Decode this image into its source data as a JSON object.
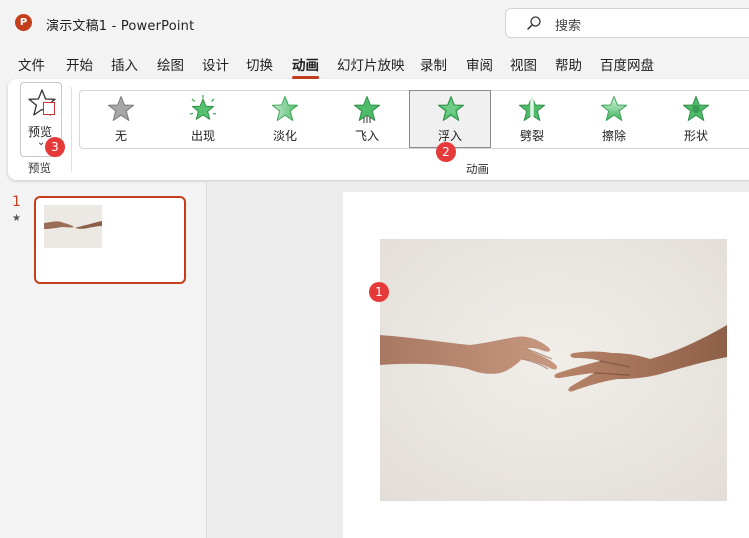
{
  "titlebar": {
    "app_name": "PowerPoint",
    "doc_title": "演示文稿1  -  PowerPoint",
    "search_placeholder": "搜索",
    "app_logo_letter": "P"
  },
  "menu": {
    "tabs": [
      {
        "label": "文件"
      },
      {
        "label": "开始"
      },
      {
        "label": "插入"
      },
      {
        "label": "绘图"
      },
      {
        "label": "设计"
      },
      {
        "label": "切换"
      },
      {
        "label": "动画",
        "active": true
      },
      {
        "label": "幻灯片放映"
      },
      {
        "label": "录制"
      },
      {
        "label": "审阅"
      },
      {
        "label": "视图"
      },
      {
        "label": "帮助"
      },
      {
        "label": "百度网盘"
      }
    ]
  },
  "ribbon": {
    "preview": {
      "button_label": "预览",
      "group_label": "预览"
    },
    "animation_group_label": "动画",
    "animations": [
      {
        "label": "无",
        "icon": "star-gray-icon"
      },
      {
        "label": "出现",
        "icon": "star-appear-icon"
      },
      {
        "label": "淡化",
        "icon": "star-fade-icon"
      },
      {
        "label": "飞入",
        "icon": "star-fly-in-icon"
      },
      {
        "label": "浮入",
        "icon": "star-float-in-icon",
        "selected": true
      },
      {
        "label": "劈裂",
        "icon": "star-split-icon"
      },
      {
        "label": "擦除",
        "icon": "star-wipe-icon"
      },
      {
        "label": "形状",
        "icon": "star-shape-icon"
      }
    ]
  },
  "badges": {
    "slide_image": "1",
    "float_in": "2",
    "preview": "3"
  },
  "thumbnails": [
    {
      "number": "1",
      "has_animation_marker": "★"
    }
  ],
  "colors": {
    "accent": "#c43e1c",
    "badge": "#e63a3a",
    "star_green": "#3fae5b",
    "star_gray": "#9a9a9a"
  }
}
